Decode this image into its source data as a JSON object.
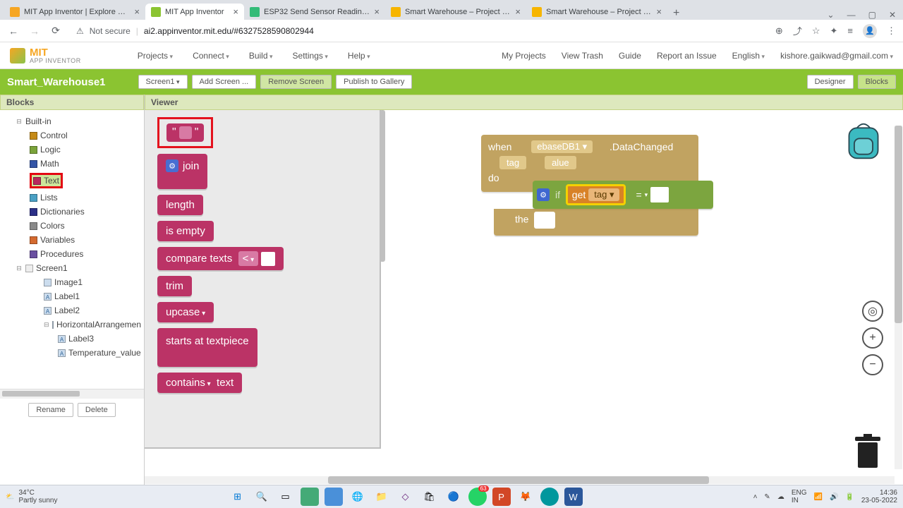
{
  "browser": {
    "tabs": [
      {
        "title": "MIT App Inventor | Explore MIT A"
      },
      {
        "title": "MIT App Inventor"
      },
      {
        "title": "ESP32 Send Sensor Readings to G"
      },
      {
        "title": "Smart Warehouse – Project settin"
      },
      {
        "title": "Smart Warehouse – Project settin"
      }
    ],
    "not_secure": "Not secure",
    "url": "ai2.appinventor.mit.edu/#6327528590802944",
    "win": {
      "dropdown": "⌄",
      "min": "—",
      "max": "▢",
      "close": "✕"
    }
  },
  "header": {
    "logo1": "MIT",
    "logo2": "APP INVENTOR",
    "menu": [
      "Projects",
      "Connect",
      "Build",
      "Settings",
      "Help"
    ],
    "right": [
      "My Projects",
      "View Trash",
      "Guide",
      "Report an Issue"
    ],
    "lang": "English",
    "email": "kishore.gaikwad@gmail.com"
  },
  "greenbar": {
    "project": "Smart_Warehouse1",
    "screen": "Screen1",
    "add": "Add Screen ...",
    "remove": "Remove Screen",
    "publish": "Publish to Gallery",
    "designer": "Designer",
    "blocks": "Blocks"
  },
  "panels": {
    "blocks": "Blocks",
    "viewer": "Viewer"
  },
  "tree": {
    "builtin": "Built-in",
    "items": [
      {
        "label": "Control",
        "color": "#c58a17"
      },
      {
        "label": "Logic",
        "color": "#7aa33a"
      },
      {
        "label": "Math",
        "color": "#3455a6"
      },
      {
        "label": "Text",
        "color": "#b8295e",
        "boxed": true
      },
      {
        "label": "Lists",
        "color": "#4aa0c4"
      },
      {
        "label": "Dictionaries",
        "color": "#2b2f87"
      },
      {
        "label": "Colors",
        "color": "#8a8a8a"
      },
      {
        "label": "Variables",
        "color": "#d46a2f"
      },
      {
        "label": "Procedures",
        "color": "#6a4fa0"
      }
    ],
    "screen": "Screen1",
    "comps": [
      "Image1",
      "Label1",
      "Label2"
    ],
    "ha": "HorizontalArrangemen",
    "ha_children": [
      "Label3",
      "Temperature_value"
    ],
    "rename": "Rename",
    "delete": "Delete"
  },
  "flyout": {
    "string_q1": "\"",
    "string_q2": "\"",
    "join": "join",
    "length": "length",
    "isempty": "is empty",
    "compare": "compare texts",
    "lt": "<",
    "trim": "trim",
    "upcase": "upcase",
    "starts": "starts at  text",
    "piece": "piece",
    "contains": "contains",
    "text": "text"
  },
  "canvas": {
    "when": "when",
    "component": "ebaseDB1",
    "event": ".DataChanged",
    "tag": "tag",
    "value": "alue",
    "do": "do",
    "if": "if",
    "get": "get",
    "tagvar": "tag",
    "eq": "=",
    "then": "the"
  },
  "taskbar": {
    "temp": "34°C",
    "cond": "Partly sunny",
    "lang": "ENG",
    "region": "IN",
    "time": "14:36",
    "date": "23-05-2022"
  }
}
